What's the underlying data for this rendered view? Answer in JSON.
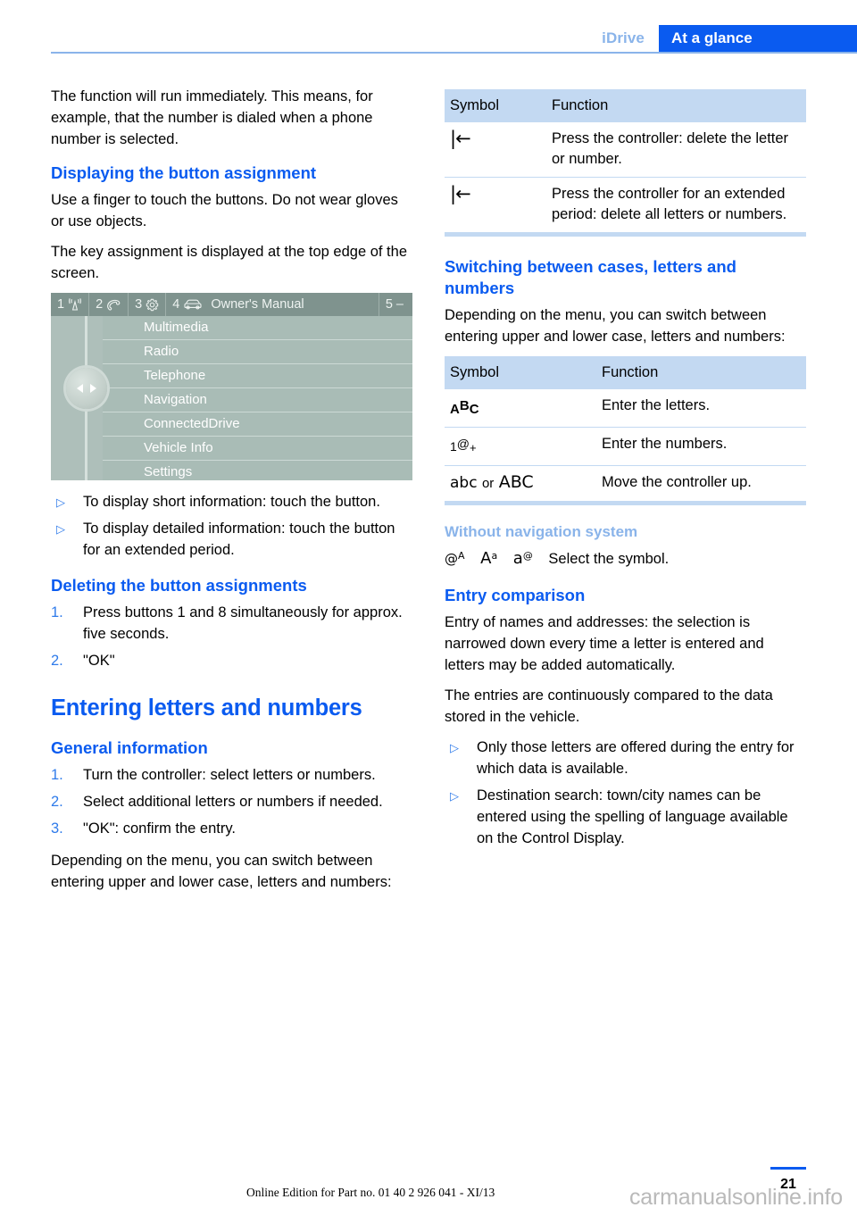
{
  "header": {
    "chapter": "iDrive",
    "section": "At a glance"
  },
  "left_column": {
    "intro_paragraph": "The function will run immediately. This means, for example, that the number is dialed when a phone number is selected.",
    "heading_displaying": "Displaying the button assignment",
    "para_touch": "Use a finger to touch the buttons. Do not wear gloves or use objects.",
    "para_key_assignment": "The key assignment is displayed at the top edge of the screen.",
    "idrive_screenshot": {
      "topbar": [
        {
          "number": "1",
          "icon": "radio-waves-icon"
        },
        {
          "number": "2",
          "icon": "telephone-handset-icon"
        },
        {
          "number": "3",
          "icon": "gear-icon"
        },
        {
          "number": "4",
          "icon": "car-icon"
        }
      ],
      "title": "Owner's Manual",
      "right_label": "5 –",
      "menu_items": [
        "Multimedia",
        "Radio",
        "Telephone",
        "Navigation",
        "ConnectedDrive",
        "Vehicle Info",
        "Settings"
      ]
    },
    "bullets_display": [
      "To display short information: touch the button.",
      "To display detailed information: touch the button for an extended period."
    ],
    "heading_deleting": "Deleting the button assignments",
    "steps_deleting": [
      {
        "num": "1.",
        "text": "Press buttons 1 and 8 simultaneously for approx. five seconds."
      },
      {
        "num": "2.",
        "text": "\"OK\""
      }
    ],
    "chapter_title": "Entering letters and numbers",
    "heading_general": "General information",
    "steps_general": [
      {
        "num": "1.",
        "text": "Turn the controller: select letters or numbers."
      },
      {
        "num": "2.",
        "text": "Select additional letters or numbers if needed."
      },
      {
        "num": "3.",
        "text": "\"OK\": confirm the entry."
      }
    ],
    "para_switching": "Depending on the menu, you can switch between entering upper and lower case, letters and numbers:"
  },
  "right_column": {
    "table_delete": {
      "headers": [
        "Symbol",
        "Function"
      ],
      "rows": [
        {
          "symbol": "backspace-icon",
          "symbol_text": "|←",
          "function": "Press the controller: delete the letter or number."
        },
        {
          "symbol": "backspace-icon",
          "symbol_text": "|←",
          "function": "Press the controller for an extended period: delete all letters or numbers."
        }
      ]
    },
    "heading_switching": "Switching between cases, letters and numbers",
    "para_switching": "Depending on the menu, you can switch between entering upper and lower case, letters and numbers:",
    "table_cases": {
      "headers": [
        "Symbol",
        "Function"
      ],
      "rows": [
        {
          "symbol": "abc-letters-icon",
          "symbol_text": "AᴮC",
          "function": "Enter the letters."
        },
        {
          "symbol": "numbers-icon",
          "symbol_text": "1@+",
          "function": "Enter the numbers."
        },
        {
          "symbol": "case-switch-icon",
          "symbol_text": "abc or ABC",
          "function": "Move the controller up."
        }
      ]
    },
    "heading_without_nav": "Without navigation system",
    "without_nav_symbols": [
      "@ᴬ",
      "Aᵃ",
      "a@"
    ],
    "without_nav_text": "Select the symbol.",
    "heading_entry_comparison": "Entry comparison",
    "para_entry_1": "Entry of names and addresses: the selection is narrowed down every time a letter is entered and letters may be added automatically.",
    "para_entry_2": "The entries are continuously compared to the data stored in the vehicle.",
    "bullets_entry": [
      "Only those letters are offered during the entry for which data is available.",
      "Destination search: town/city names can be entered using the spelling of language available on the Control Display."
    ]
  },
  "footer": {
    "note": "Online Edition for Part no. 01 40 2 926 041 - XI/13",
    "page_number": "21",
    "watermark": "carmanualsonline.info"
  },
  "colors": {
    "accent_blue": "#0a5bf0",
    "light_blue": "#8ab4ea",
    "table_header": "#c3d9f2",
    "idrive_bg": "#aebfba"
  }
}
